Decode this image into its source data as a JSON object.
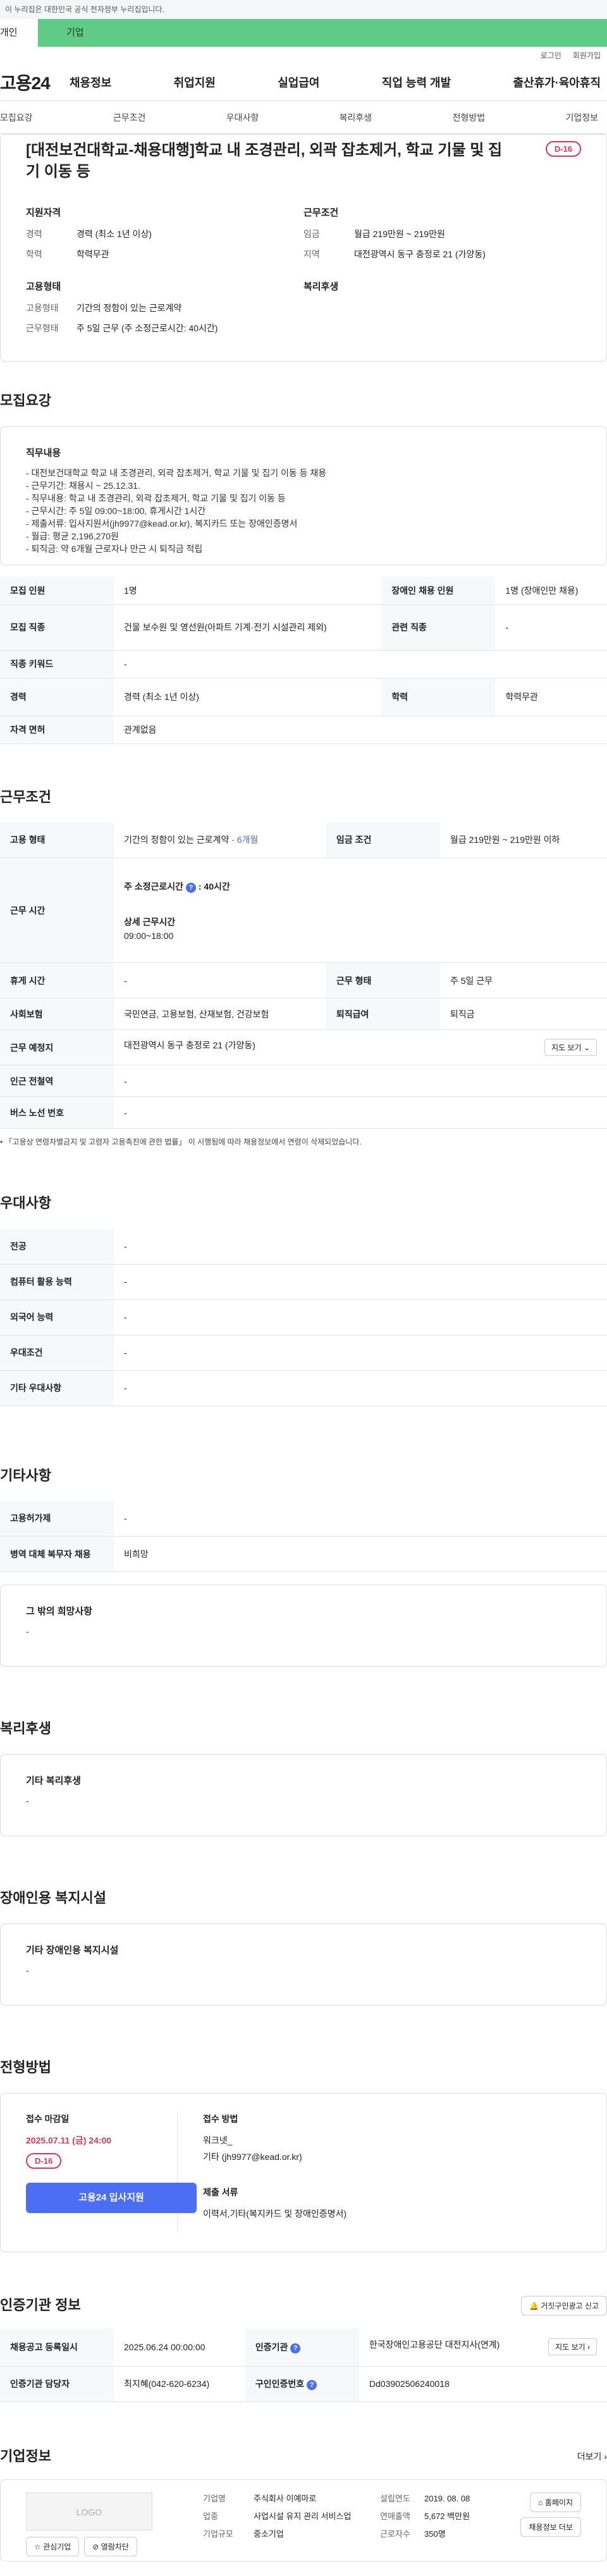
{
  "topbar": {
    "notice": "이 누리집은 대한민국 공식 전자정부 누리집입니다."
  },
  "tabs": {
    "individual": "개인",
    "corporate": "기업"
  },
  "util": {
    "login": "로그인",
    "signup": "회원가입"
  },
  "gnb": {
    "logo": "고용24",
    "menu": [
      "채용정보",
      "취업지원",
      "실업급여",
      "직업 능력 개발",
      "출산휴가·육아휴직"
    ]
  },
  "subnav": [
    "모집요강",
    "근무조건",
    "우대사항",
    "복리후생",
    "전형방법",
    "기업정보"
  ],
  "summary": {
    "title": "[대전보건대학교-채용대행]학교 내 조경관리, 외곽 잡초제거, 학교 기물 및 집기 이동 등",
    "dday": "D-16",
    "qual_h": "지원자격",
    "qual": [
      [
        "경력",
        "경력 (최소 1년 이상)"
      ],
      [
        "학력",
        "학력무관"
      ]
    ],
    "cond_h": "근무조건",
    "cond": [
      [
        "임금",
        "월급 219만원 ~ 219만원"
      ],
      [
        "지역",
        "대전광역시 동구 충정로 21 (가양동)"
      ]
    ],
    "emp_h": "고용형태",
    "emp": [
      [
        "고용형태",
        "기간의 정함이 있는 근로계약"
      ],
      [
        "근무형태",
        "주 5일 근무 (주 소정근로시간: 40시간)"
      ]
    ],
    "welfare_h": "복리후생"
  },
  "recruit": {
    "title": "모집요강",
    "duty_h": "직무내용",
    "duty": "- 대전보건대학교 학교 내 조경관리, 외곽 잡초제거, 학교 기물 및 집기 이동 등 채용\n- 근무기간: 채용시 ~ 25.12.31.\n- 직무내용: 학교 내 조경관리, 외곽 잡초제거, 학교 기물 및 집기 이동 등\n- 근무시간: 주 5일 09:00~18:00, 휴게시간 1시간\n- 제출서류: 입사지원서(jh9977@kead.or.kr), 복지카드 또는 장애인증명서\n- 월급: 평균 2,196,270원\n- 퇴직금: 약 6개월 근로자나 만근 시 퇴직금 적립",
    "rows": [
      [
        "모집 인원",
        "1명",
        "장애인 채용 인원",
        "1명 (장애인만 채용)"
      ],
      [
        "모집 직종",
        "건물 보수원 및 영선원(아파트 기계·전기 시설관리 제외)",
        "관련 직종",
        "-"
      ],
      [
        "직종 키워드",
        "-",
        "",
        ""
      ],
      [
        "경력",
        "경력 (최소 1년 이상)",
        "학력",
        "학력무관"
      ],
      [
        "자격 면허",
        "관계없음",
        "",
        ""
      ]
    ]
  },
  "work": {
    "title": "근무조건",
    "emp_k": "고용 형태",
    "emp_v": "기간의 정함이 있는 근로계약",
    "emp_period": "6개월",
    "wage_k": "임금 조건",
    "wage_v": "월급 219만원 ~ 219만원 이하",
    "hours_k": "근무 시간",
    "hours_weekly_label": "주 소정근로시간",
    "hours_weekly": "40시간",
    "hours_detail_h": "상세 근무시간",
    "hours_detail": "09:00~18:00",
    "rest_k": "휴게 시간",
    "rest_v": "-",
    "form_k": "근무 형태",
    "form_v": "주 5일 근무",
    "ins_k": "사회보험",
    "ins_v": "국민연금, 고용보험, 산재보험, 건강보험",
    "sev_k": "퇴직급여",
    "sev_v": "퇴직금",
    "place_k": "근무 예정지",
    "place_v": "대전광역시 동구 충정로 21 (가양동)",
    "map_btn": "지도 보기",
    "station_k": "인근 전철역",
    "station_v": "-",
    "bus_k": "버스 노선 번호",
    "bus_v": "-",
    "note": "「고용상 연령차별금지 및 고령자 고용촉진에 관한 법률」 이 시행됨에 따라 채용정보에서 연령이 삭제되었습니다."
  },
  "pref": {
    "title": "우대사항",
    "rows": [
      [
        "전공",
        "-"
      ],
      [
        "컴퓨터 활용 능력",
        "-"
      ],
      [
        "외국어 능력",
        "-"
      ],
      [
        "우대조건",
        "-"
      ],
      [
        "기타 우대사항",
        "-"
      ]
    ]
  },
  "etc": {
    "title": "기타사항",
    "rows": [
      [
        "고용허가제",
        "-"
      ],
      [
        "병역 대체 복무자 채용",
        "비희망"
      ]
    ],
    "hope_h": "그 밖의 희망사항",
    "hope_v": "-"
  },
  "welfare": {
    "title": "복리후생",
    "h": "기타 복리후생",
    "v": "-"
  },
  "facility": {
    "title": "장애인용 복지시설",
    "h": "기타 장애인용 복지시설",
    "v": "-"
  },
  "selection": {
    "title": "전형방법",
    "deadline_h": "접수 마감일",
    "deadline": "2025.07.11 (금) 24:00",
    "dday": "D-16",
    "apply_btn": "고용24 입사지원",
    "method_h": "접수 방법",
    "method_1": "워크넷_",
    "method_2": "기타 (jh9977@kead.or.kr)",
    "docs_h": "제출 서류",
    "docs": "이력서,기타(복지카드 및 장애인증명서)"
  },
  "cert": {
    "title": "인증기관 정보",
    "report_btn": "거짓구인광고 신고",
    "reg_k": "채용공고 등록일시",
    "reg_v": "2025.06.24 00:00:00",
    "org_k": "인증기관",
    "org_v": "한국장애인고용공단 대전지사(연계)",
    "org_map": "지도 보기",
    "mgr_k": "인증기관 담당자",
    "mgr_v": "최지혜(042-620-6234)",
    "id_k": "구인인증번호",
    "id_v": "Dd03902506240018"
  },
  "company": {
    "title": "기업정보",
    "more": "더보기",
    "logo": "LOGO",
    "fav_btn": "관심기업",
    "block_btn": "열람차단",
    "name_k": "기업명",
    "name_v": "주식회사 이예마로",
    "ind_k": "업종",
    "ind_v": "사업시설 유지 관리 서비스업",
    "size_k": "기업규모",
    "size_v": "중소기업",
    "est_k": "설립연도",
    "est_v": "2019. 08. 08",
    "sales_k": "연매출액",
    "sales_v": "5,672 백만원",
    "emp_k": "근로자수",
    "emp_v": "350명",
    "home_btn": "홈페이지",
    "jobs_btn": "채용정보 더보"
  }
}
